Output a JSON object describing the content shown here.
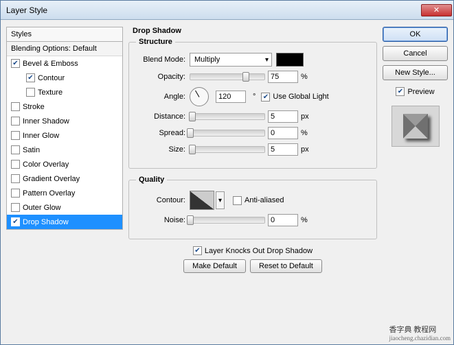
{
  "window": {
    "title": "Layer Style"
  },
  "styles": {
    "header": "Styles",
    "blending_options": "Blending Options: Default",
    "items": [
      {
        "label": "Bevel & Emboss",
        "checked": true,
        "indent": false
      },
      {
        "label": "Contour",
        "checked": true,
        "indent": true
      },
      {
        "label": "Texture",
        "checked": false,
        "indent": true
      },
      {
        "label": "Stroke",
        "checked": false,
        "indent": false
      },
      {
        "label": "Inner Shadow",
        "checked": false,
        "indent": false
      },
      {
        "label": "Inner Glow",
        "checked": false,
        "indent": false
      },
      {
        "label": "Satin",
        "checked": false,
        "indent": false
      },
      {
        "label": "Color Overlay",
        "checked": false,
        "indent": false
      },
      {
        "label": "Gradient Overlay",
        "checked": false,
        "indent": false
      },
      {
        "label": "Pattern Overlay",
        "checked": false,
        "indent": false
      },
      {
        "label": "Outer Glow",
        "checked": false,
        "indent": false
      },
      {
        "label": "Drop Shadow",
        "checked": true,
        "indent": false,
        "selected": true
      }
    ]
  },
  "panel": {
    "title": "Drop Shadow",
    "structure": {
      "legend": "Structure",
      "blend_mode_label": "Blend Mode:",
      "blend_mode_value": "Multiply",
      "color": "#000000",
      "opacity_label": "Opacity:",
      "opacity_value": "75",
      "opacity_unit": "%",
      "angle_label": "Angle:",
      "angle_value": "120",
      "angle_unit": "°",
      "use_global_light": "Use Global Light",
      "use_global_light_checked": true,
      "distance_label": "Distance:",
      "distance_value": "5",
      "distance_unit": "px",
      "spread_label": "Spread:",
      "spread_value": "0",
      "spread_unit": "%",
      "size_label": "Size:",
      "size_value": "5",
      "size_unit": "px"
    },
    "quality": {
      "legend": "Quality",
      "contour_label": "Contour:",
      "anti_aliased": "Anti-aliased",
      "anti_aliased_checked": false,
      "noise_label": "Noise:",
      "noise_value": "0",
      "noise_unit": "%"
    },
    "knocks_out": "Layer Knocks Out Drop Shadow",
    "knocks_out_checked": true,
    "make_default": "Make Default",
    "reset_default": "Reset to Default"
  },
  "right": {
    "ok": "OK",
    "cancel": "Cancel",
    "new_style": "New Style...",
    "preview": "Preview",
    "preview_checked": true
  },
  "watermark": {
    "line1": "香字典 教程网",
    "line2": "jiaocheng.chazidian.com"
  }
}
